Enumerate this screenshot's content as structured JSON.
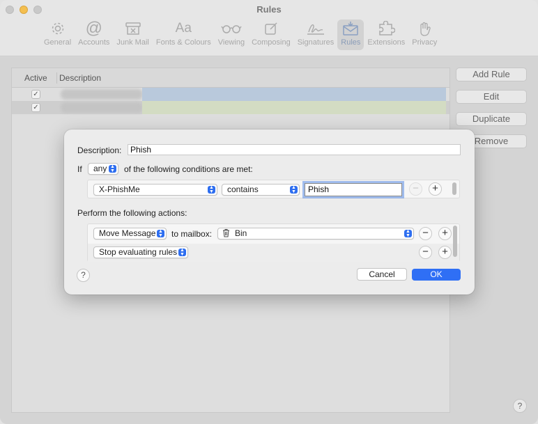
{
  "window": {
    "title": "Rules"
  },
  "toolbar": {
    "items": [
      {
        "label": "General",
        "icon": "gear-icon"
      },
      {
        "label": "Accounts",
        "icon": "at-icon"
      },
      {
        "label": "Junk Mail",
        "icon": "junk-icon"
      },
      {
        "label": "Fonts & Colours",
        "icon": "fonts-icon"
      },
      {
        "label": "Viewing",
        "icon": "glasses-icon"
      },
      {
        "label": "Composing",
        "icon": "compose-icon"
      },
      {
        "label": "Signatures",
        "icon": "signature-icon"
      },
      {
        "label": "Rules",
        "icon": "rules-icon",
        "active": true
      },
      {
        "label": "Extensions",
        "icon": "puzzle-icon"
      },
      {
        "label": "Privacy",
        "icon": "hand-icon"
      }
    ]
  },
  "rules_table": {
    "columns": [
      "Active",
      "Description"
    ],
    "rows": [
      {
        "active": true,
        "color": "#b9c9dc"
      },
      {
        "active": true,
        "color": "#d3dcc3"
      }
    ]
  },
  "side_buttons": {
    "add": "Add Rule",
    "edit": "Edit",
    "duplicate": "Duplicate",
    "remove": "Remove"
  },
  "sheet": {
    "description_label": "Description:",
    "description_value": "Phish",
    "if_label": "If",
    "match_mode": "any",
    "conditions_suffix": "of the following conditions are met:",
    "condition": {
      "header": "X-PhishMe",
      "operator": "contains",
      "value": "Phish"
    },
    "actions_label": "Perform the following actions:",
    "actions": [
      {
        "action": "Move Message",
        "to_label": "to mailbox:",
        "mailbox": "Bin"
      },
      {
        "action": "Stop evaluating rules"
      }
    ],
    "help": "?",
    "cancel": "Cancel",
    "ok": "OK"
  },
  "help_bottom": "?",
  "colors": {
    "accent": "#2f6ff5"
  }
}
